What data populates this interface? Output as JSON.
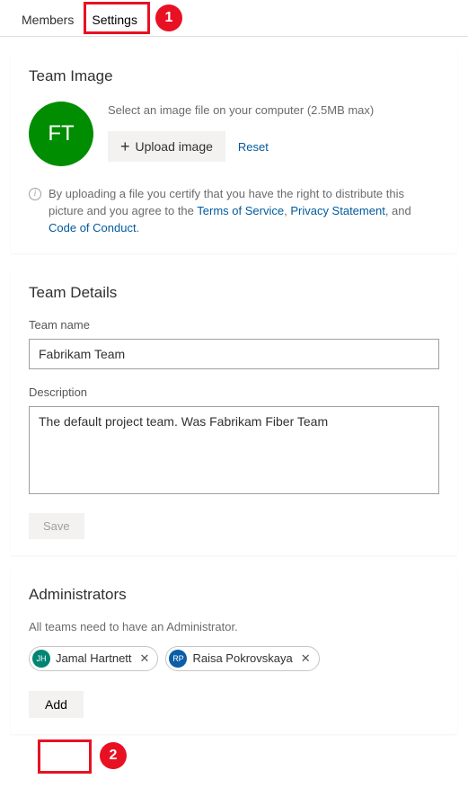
{
  "tabs": {
    "members": "Members",
    "settings": "Settings"
  },
  "teamImage": {
    "title": "Team Image",
    "initials": "FT",
    "hint": "Select an image file on your computer (2.5MB max)",
    "uploadLabel": "Upload image",
    "resetLabel": "Reset",
    "disclaimerPrefix": "By uploading a file you certify that you have the right to distribute this picture and you agree to the ",
    "tosLink": "Terms of Service",
    "comma1": ", ",
    "privacyLink": "Privacy Statement",
    "comma2": ", and ",
    "codeLink": "Code of Conduct",
    "period": "."
  },
  "teamDetails": {
    "title": "Team Details",
    "nameLabel": "Team name",
    "nameValue": "Fabrikam Team",
    "descLabel": "Description",
    "descValue": "The default project team. Was Fabrikam Fiber Team",
    "saveLabel": "Save"
  },
  "admins": {
    "title": "Administrators",
    "helper": "All teams need to have an Administrator.",
    "list": [
      {
        "initials": "JH",
        "name": "Jamal Hartnett",
        "color": "#008575"
      },
      {
        "initials": "RP",
        "name": "Raisa Pokrovskaya",
        "color": "#0a5da7"
      }
    ],
    "addLabel": "Add"
  },
  "callouts": {
    "c1": "1",
    "c2": "2"
  }
}
